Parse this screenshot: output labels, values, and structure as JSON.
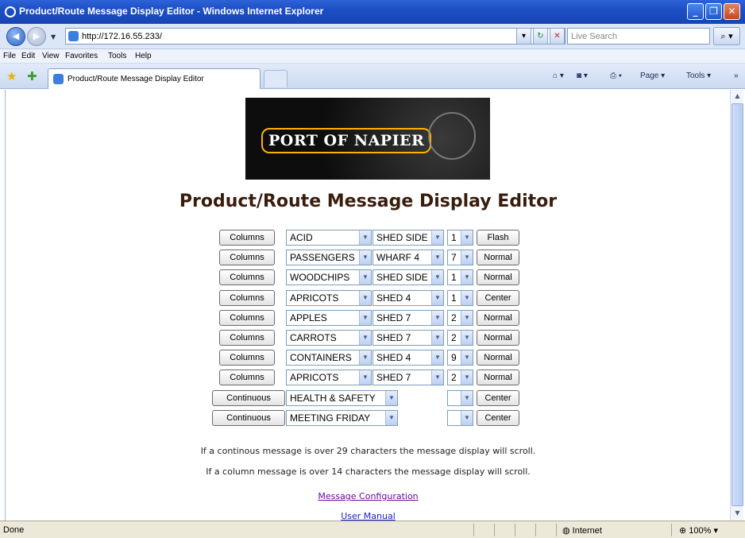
{
  "window": {
    "title": "Product/Route Message Display Editor - Windows Internet Explorer"
  },
  "address": {
    "url": "http://172.16.55.233/",
    "search_placeholder": "Live Search"
  },
  "menu": [
    "File",
    "Edit",
    "View",
    "Favorites",
    "Tools",
    "Help"
  ],
  "tab": {
    "label": "Product/Route Message Display Editor"
  },
  "commands": {
    "page": "Page",
    "tools": "Tools"
  },
  "page": {
    "logo_text": "PORT OF NAPIER",
    "title": "Product/Route Message Display Editor",
    "rows": [
      {
        "mode": "Columns",
        "message": "ACID",
        "location": "SHED SIDE",
        "number": "1",
        "action": "Flash"
      },
      {
        "mode": "Columns",
        "message": "PASSENGERS",
        "location": "WHARF 4",
        "number": "7",
        "action": "Normal"
      },
      {
        "mode": "Columns",
        "message": "WOODCHIPS",
        "location": "SHED SIDE",
        "number": "1",
        "action": "Normal"
      },
      {
        "mode": "Columns",
        "message": "APRICOTS",
        "location": "SHED 4",
        "number": "1",
        "action": "Center"
      },
      {
        "mode": "Columns",
        "message": "APPLES",
        "location": "SHED 7",
        "number": "2",
        "action": "Normal"
      },
      {
        "mode": "Columns",
        "message": "CARROTS",
        "location": "SHED 7",
        "number": "2",
        "action": "Normal"
      },
      {
        "mode": "Columns",
        "message": "CONTAINERS",
        "location": "SHED 4",
        "number": "9",
        "action": "Normal"
      },
      {
        "mode": "Columns",
        "message": "APRICOTS",
        "location": "SHED 7",
        "number": "2",
        "action": "Normal"
      },
      {
        "mode": "Continuous",
        "message": "HEALTH & SAFETY",
        "location": "",
        "number": "",
        "action": "Center"
      },
      {
        "mode": "Continuous",
        "message": "MEETING FRIDAY",
        "location": "",
        "number": "",
        "action": "Center"
      }
    ],
    "note1": "If a continous message is over 29 characters the message display will scroll.",
    "note2": "If a column message is over 14 characters the message display will scroll.",
    "link_config": "Message Configuration",
    "link_manual": "User Manual"
  },
  "status": {
    "text": "Done",
    "zone": "Internet",
    "zoom": "100%"
  }
}
